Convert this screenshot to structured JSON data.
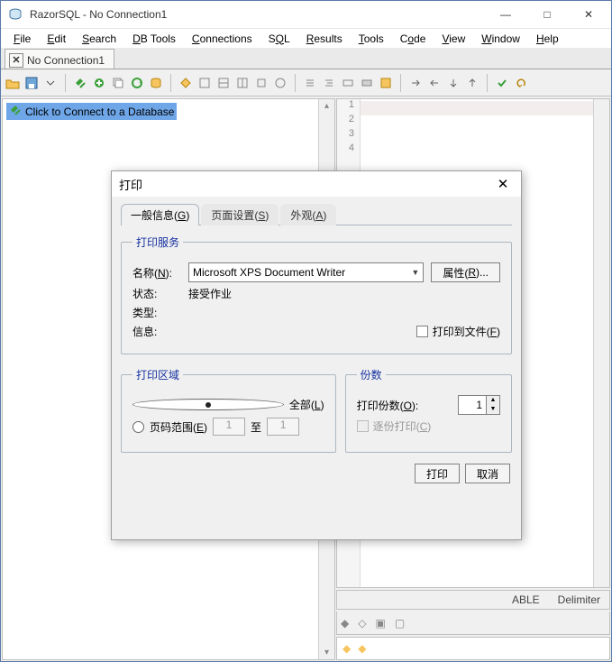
{
  "window": {
    "title": "RazorSQL - No Connection1",
    "minimize": "—",
    "maximize": "□",
    "close": "✕"
  },
  "menubar": [
    "File",
    "Edit",
    "Search",
    "DB Tools",
    "Connections",
    "SQL",
    "Results",
    "Tools",
    "Code",
    "View",
    "Window",
    "Help"
  ],
  "tabs": {
    "doc1": "No Connection1",
    "close": "✕"
  },
  "tree": {
    "connect_label": "Click to Connect to a Database"
  },
  "editor": {
    "lines": [
      "1",
      "2",
      "3",
      "4"
    ]
  },
  "results_hdr": [
    "ABLE",
    "Delimiter"
  ],
  "dialog": {
    "title": "打印",
    "tabs": {
      "general": "一般信息(G)",
      "pagesetup": "页面设置(S)",
      "appearance": "外观(A)"
    },
    "service_grp": "打印服务",
    "name_lbl": "名称(N):",
    "writer": "Microsoft XPS Document Writer",
    "properties": "属性(R)...",
    "status_lbl": "状态:",
    "status_val": "接受作业",
    "type_lbl": "类型:",
    "info_lbl": "信息:",
    "print_to_file": "打印到文件(F)",
    "range_grp": "打印区域",
    "all": "全部(L)",
    "pages": "页码范围(E)",
    "from": "1",
    "to_lbl": "至",
    "to": "1",
    "copies_grp": "份数",
    "copies_lbl": "打印份数(O):",
    "copies_val": "1",
    "collate": "逐份打印(C)",
    "ok": "打印",
    "cancel": "取消"
  }
}
